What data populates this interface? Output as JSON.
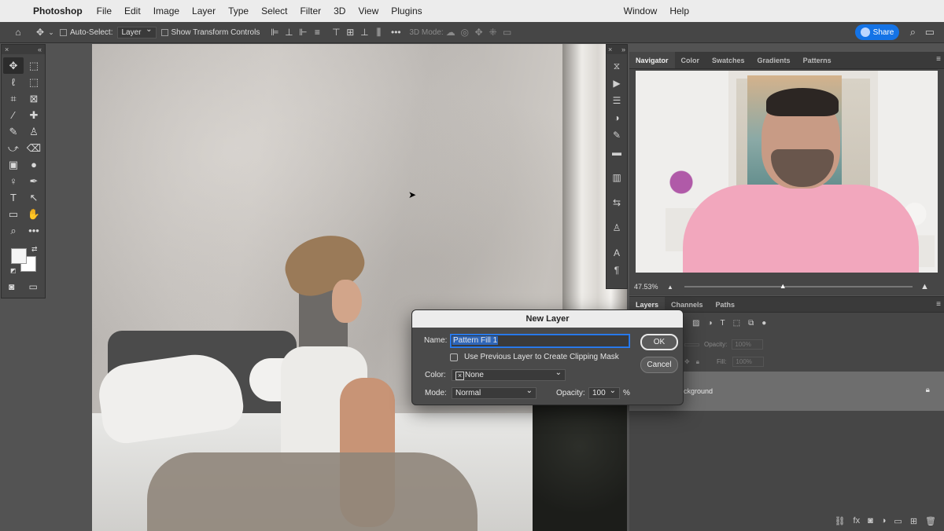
{
  "menubar": {
    "app_name": "Photoshop",
    "items": [
      "File",
      "Edit",
      "Image",
      "Layer",
      "Type",
      "Select",
      "Filter",
      "3D",
      "View",
      "Plugins"
    ],
    "window_label": "Window",
    "help_label": "Help"
  },
  "options_bar": {
    "auto_select_label": "Auto-Select:",
    "auto_select_value": "Layer",
    "transform_label": "Show Transform Controls",
    "mode_label": "3D Mode:",
    "share_label": "Share"
  },
  "navigator": {
    "tabs": [
      "Navigator",
      "Color",
      "Swatches",
      "Gradients",
      "Patterns"
    ],
    "active_tab": "Navigator",
    "zoom": "47.53%",
    "zoom_fraction": 0.43
  },
  "layers_panel": {
    "tabs": [
      "Layers",
      "Channels",
      "Paths"
    ],
    "active_tab": "Layers",
    "opacity_label": "Opacity:",
    "opacity_value": "100%",
    "fill_label": "Fill:",
    "fill_value": "100%",
    "background_layer_name": "ackground"
  },
  "dialog": {
    "title": "New Layer",
    "name_label": "Name:",
    "name_value": "Pattern Fill 1",
    "clipping_label": "Use Previous Layer to Create Clipping Mask",
    "color_label": "Color:",
    "color_value": "None",
    "mode_label": "Mode:",
    "mode_value": "Normal",
    "opacity_label": "Opacity:",
    "opacity_value": "100",
    "percent": "%",
    "ok_label": "OK",
    "cancel_label": "Cancel"
  },
  "colors": {
    "accent": "#1473e6",
    "panel": "#464646",
    "dialog": "#4a4a4a"
  }
}
